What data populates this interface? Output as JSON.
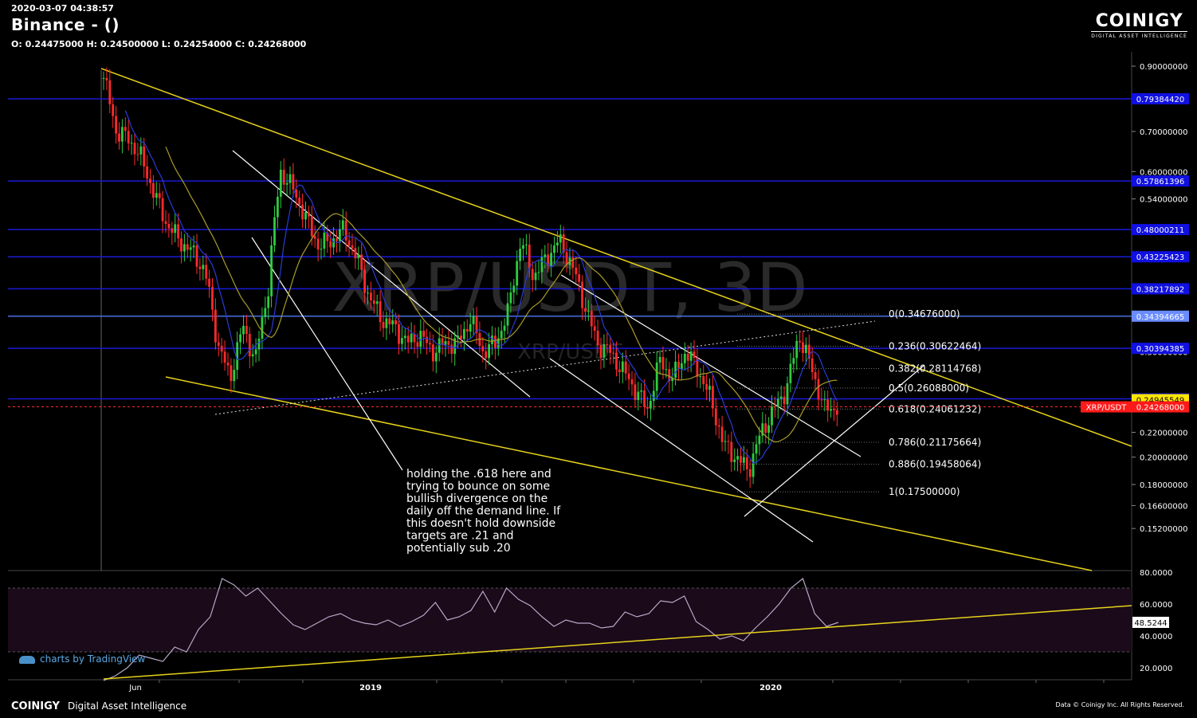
{
  "header": {
    "timestamp": "2020-03-07 04:38:57",
    "title": "Binance -  ()",
    "ohlc": "O: 0.24475000 H: 0.24500000 L: 0.24254000 C: 0.24268000"
  },
  "brand": {
    "logo": "COINIGY",
    "tagline": "DIGITAL ASSET INTELLIGENCE"
  },
  "footer": {
    "brand": "COINIGY",
    "tagline": "Digital Asset Intelligence",
    "copyright": "Data © Coinigy Inc.  All Rights Reserved."
  },
  "tradingview": "charts by TradingView",
  "colors": {
    "background": "#000000",
    "bull": "#2ecc40",
    "bear": "#ff2b2b",
    "trend": "#e6d21a",
    "level": "#1a1ad6",
    "price": "#ff2b2b",
    "annotation": "#ffffff"
  },
  "chart_data": {
    "type": "candlestick",
    "watermark": "XRP/USDT, 3D",
    "watermark_sub": "XRP/USDT",
    "x_ticks": [
      "Jun",
      "2019",
      "2020"
    ],
    "y_ticks": [
      "0.90000000",
      "0.70000000",
      "0.60000000",
      "0.54000000",
      "0.30000000",
      "0.22000000",
      "0.20000000",
      "0.18000000",
      "0.16600000",
      "0.15200000"
    ],
    "horizontal_levels": [
      "0.79384420",
      "0.57861396",
      "0.48000211",
      "0.43225423",
      "0.38217892",
      "0.34394665",
      "0.30394385",
      "0.25022198"
    ],
    "ma_label": "0.24945549",
    "price_tag": {
      "symbol": "XRP/USDT",
      "value": "0.24268000"
    },
    "fibonacci": [
      {
        "ratio": "0",
        "value": "0.34676000",
        "label": "0(0.34676000)"
      },
      {
        "ratio": "0.236",
        "value": "0.30622464",
        "label": "0.236(0.30622464)"
      },
      {
        "ratio": "0.382",
        "value": "0.28114768",
        "label": "0.382(0.28114768)"
      },
      {
        "ratio": "0.5",
        "value": "0.26088000",
        "label": "0.5(0.26088000)"
      },
      {
        "ratio": "0.618",
        "value": "0.24061232",
        "label": "0.618(0.24061232)"
      },
      {
        "ratio": "0.786",
        "value": "0.21175664",
        "label": "0.786(0.21175664)"
      },
      {
        "ratio": "0.886",
        "value": "0.19458064",
        "label": "0.886(0.19458064)"
      },
      {
        "ratio": "1",
        "value": "0.17500000",
        "label": "1(0.17500000)"
      }
    ],
    "close_path": [
      0.86,
      0.7,
      0.68,
      0.63,
      0.55,
      0.49,
      0.46,
      0.44,
      0.41,
      0.31,
      0.27,
      0.33,
      0.29,
      0.38,
      0.6,
      0.56,
      0.5,
      0.45,
      0.46,
      0.48,
      0.43,
      0.37,
      0.34,
      0.33,
      0.31,
      0.32,
      0.3,
      0.31,
      0.31,
      0.34,
      0.3,
      0.31,
      0.35,
      0.46,
      0.4,
      0.43,
      0.46,
      0.42,
      0.36,
      0.31,
      0.3,
      0.28,
      0.26,
      0.24,
      0.29,
      0.27,
      0.3,
      0.28,
      0.25,
      0.21,
      0.2,
      0.19,
      0.22,
      0.24,
      0.26,
      0.32,
      0.28,
      0.24,
      0.2427
    ],
    "annotation": "holding the .618 here and\ntrying to bounce on some\nbullish divergence on the\ndaily off the demand line. If\nthis doesn't hold downside\ntargets are .21 and\npotentially sub .20",
    "rsi": {
      "ticks": [
        "80.0000",
        "60.0000",
        "40.0000",
        "20.0000"
      ],
      "current": "48.5244",
      "upper_band": 70,
      "lower_band": 30,
      "values": [
        12,
        15,
        20,
        28,
        26,
        24,
        33,
        30,
        44,
        52,
        76,
        72,
        65,
        70,
        62,
        54,
        47,
        44,
        48,
        52,
        54,
        50,
        48,
        47,
        50,
        46,
        49,
        53,
        61,
        50,
        52,
        56,
        68,
        55,
        70,
        63,
        59,
        52,
        46,
        50,
        48,
        48,
        45,
        46,
        55,
        52,
        54,
        62,
        61,
        65,
        49,
        44,
        38,
        40,
        37,
        45,
        52,
        60,
        70,
        76,
        54,
        46,
        48.5244
      ]
    }
  }
}
